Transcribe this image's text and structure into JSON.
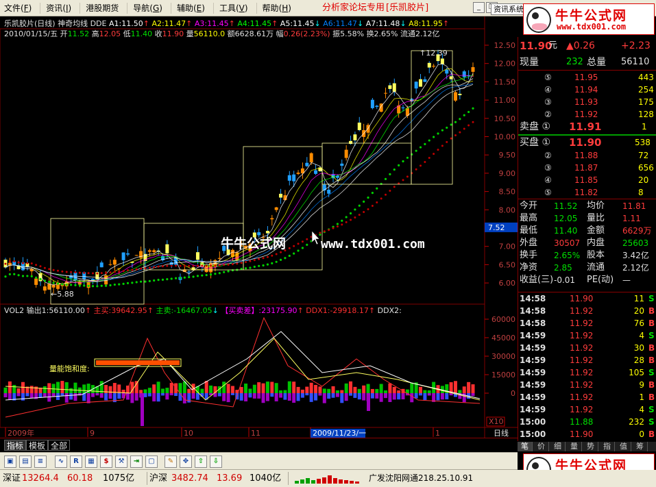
{
  "menu": [
    {
      "label": "文件",
      "acc": "F"
    },
    {
      "label": "资讯",
      "acc": "I"
    },
    {
      "label": "港股期货",
      "acc": ""
    },
    {
      "label": "导航",
      "acc": "G"
    },
    {
      "label": "辅助",
      "acc": "E"
    },
    {
      "label": "工具",
      "acc": "V"
    },
    {
      "label": "帮助",
      "acc": "H"
    }
  ],
  "forum_title": "分析家论坛专用",
  "stock_title": "[乐凯胶片]",
  "info_sys_label": "资讯系统",
  "logo": {
    "name": "牛牛公式网",
    "url": "www.tdx001.com"
  },
  "watermark": {
    "name": "牛牛公式网",
    "url": "www.tdx001.com"
  },
  "header": {
    "line1_name": "乐凯胶片(日线)",
    "line1_indicator": "神奇均线 DDE",
    "ma": [
      {
        "label": "A1:11.50",
        "arrow": "↑",
        "color": "#ffffff"
      },
      {
        "label": "A2:11.47",
        "arrow": "↑",
        "color": "#ffff00"
      },
      {
        "label": "A3:11.45",
        "arrow": "↑",
        "color": "#ff00ff"
      },
      {
        "label": "A4:11.45",
        "arrow": "↑",
        "color": "#00ff00"
      },
      {
        "label": "A5:11.45",
        "arrow": "↓",
        "color": "#ffffff"
      },
      {
        "label": "A6:11.47",
        "arrow": "↓",
        "color": "#0080ff"
      },
      {
        "label": "A7:11.48",
        "arrow": "↓",
        "color": "#ffffff"
      },
      {
        "label": "A8:11.95",
        "arrow": "↑",
        "color": "#ffff00"
      }
    ],
    "date": "2010/01/15/五",
    "open_label": "开",
    "open": "11.52",
    "high_label": "高",
    "high": "12.05",
    "low_label": "低",
    "low": "11.40",
    "close_label": "收",
    "close": "11.90",
    "vol_label": "量",
    "vol": "56110.0",
    "amt_label": "额",
    "amt": "6628.61万",
    "chg_label": "幅",
    "chg": "0.26(2.23%)",
    "swing": "振5.58%",
    "turnover": "换2.65%",
    "float": "流通2.12亿"
  },
  "price_axis": [
    "12.50",
    "12.00",
    "11.50",
    "11.00",
    "10.50",
    "10.00",
    "9.50",
    "9.00",
    "8.50",
    "8.00",
    "7.50",
    "7.00",
    "6.50",
    "6.00"
  ],
  "price_marker": "7.52",
  "annotations": {
    "high_label": "12.39",
    "low_label": "5.88"
  },
  "vol_header": {
    "name": "VOL2",
    "out1": "输出1:56110.00",
    "out1_arrow": "↑",
    "buy": "主买:39642.95",
    "buy_arrow": "↑",
    "sell": "主卖:-16467.05",
    "sell_arrow": "↓",
    "diff_label": "【买卖差】",
    "diff": ":23175.90",
    "diff_arrow": "↑",
    "ddx1": "DDX1:-29918.17",
    "ddx1_arrow": "↑",
    "ddx2": "DDX2:"
  },
  "vol_axis": [
    "60000",
    "45000",
    "30000",
    "15000",
    "0"
  ],
  "vol_scale": "X10",
  "saturation_label": "量能饱和度:",
  "time_axis": [
    {
      "label": "2009年"
    },
    {
      "label": "9"
    },
    {
      "label": "10"
    },
    {
      "label": "11"
    },
    {
      "label": "2009/11/23/一"
    },
    {
      "label": "1"
    }
  ],
  "period_label": "日线",
  "bottom_tabs": [
    "指标",
    "模板",
    "全部"
  ],
  "quote": {
    "price": "11.90",
    "unit": "元",
    "chg": "▲0.26",
    "pct": "+2.23",
    "now_vol_label": "现量",
    "now_vol": "232",
    "total_vol_label": "总量",
    "total_vol": "56110",
    "asks": [
      {
        "lvl": "⑤",
        "price": "11.95",
        "vol": "443"
      },
      {
        "lvl": "④",
        "price": "11.94",
        "vol": "254"
      },
      {
        "lvl": "③",
        "price": "11.93",
        "vol": "175"
      },
      {
        "lvl": "②",
        "price": "11.92",
        "vol": "128"
      }
    ],
    "ask1": {
      "label": "卖盘 ①",
      "price": "11.91",
      "vol": "1"
    },
    "bid1": {
      "label": "买盘 ①",
      "price": "11.90",
      "vol": "538"
    },
    "bids": [
      {
        "lvl": "②",
        "price": "11.88",
        "vol": "72"
      },
      {
        "lvl": "③",
        "price": "11.87",
        "vol": "656"
      },
      {
        "lvl": "④",
        "price": "11.85",
        "vol": "20"
      },
      {
        "lvl": "⑤",
        "price": "11.82",
        "vol": "8"
      }
    ],
    "stats": [
      {
        "l1": "今开",
        "v1": "11.52",
        "l2": "均价",
        "v2": "11.81"
      },
      {
        "l1": "最高",
        "v1": "12.05",
        "l2": "量比",
        "v2": "1.11"
      },
      {
        "l1": "最低",
        "v1": "11.40",
        "l2": "金额",
        "v2": "6629万"
      },
      {
        "l1": "外盘",
        "v1": "30507",
        "l2": "内盘",
        "v2": "25603"
      },
      {
        "l1": "换手",
        "v1": "2.65%",
        "l2": "股本",
        "v2": "3.42亿"
      },
      {
        "l1": "净资",
        "v1": "2.85",
        "l2": "流通",
        "v2": "2.12亿"
      },
      {
        "l1": "收益(三)",
        "v1": "-0.01",
        "l2": "PE(动)",
        "v2": "—"
      }
    ],
    "ticks": [
      {
        "t": "14:58",
        "p": "11.90",
        "v": "11",
        "s": "S"
      },
      {
        "t": "14:58",
        "p": "11.92",
        "v": "20",
        "s": "B"
      },
      {
        "t": "14:58",
        "p": "11.92",
        "v": "76",
        "s": "B"
      },
      {
        "t": "14:59",
        "p": "11.92",
        "v": "4",
        "s": "S"
      },
      {
        "t": "14:59",
        "p": "11.92",
        "v": "30",
        "s": "B"
      },
      {
        "t": "14:59",
        "p": "11.92",
        "v": "28",
        "s": "B"
      },
      {
        "t": "14:59",
        "p": "11.92",
        "v": "105",
        "s": "S"
      },
      {
        "t": "14:59",
        "p": "11.92",
        "v": "9",
        "s": "B"
      },
      {
        "t": "14:59",
        "p": "11.92",
        "v": "1",
        "s": "B"
      },
      {
        "t": "14:59",
        "p": "11.92",
        "v": "4",
        "s": "S"
      },
      {
        "t": "15:00",
        "p": "11.88",
        "v": "232",
        "s": "S"
      },
      {
        "t": "15:00",
        "p": "11.90",
        "v": "0",
        "s": "B"
      }
    ]
  },
  "right_tabs": [
    "笔",
    "价",
    "细",
    "量",
    "势",
    "指",
    "值",
    "筹"
  ],
  "status": {
    "sz_label": "深证",
    "sz": "13264.4",
    "sz_chg": "60.18",
    "sz_amt": "1075亿",
    "sh_label": "沪深",
    "sh": "3482.74",
    "sh_chg": "13.69",
    "sh_amt": "1040亿",
    "broker": "广发沈阳网通218.25.10.91"
  }
}
